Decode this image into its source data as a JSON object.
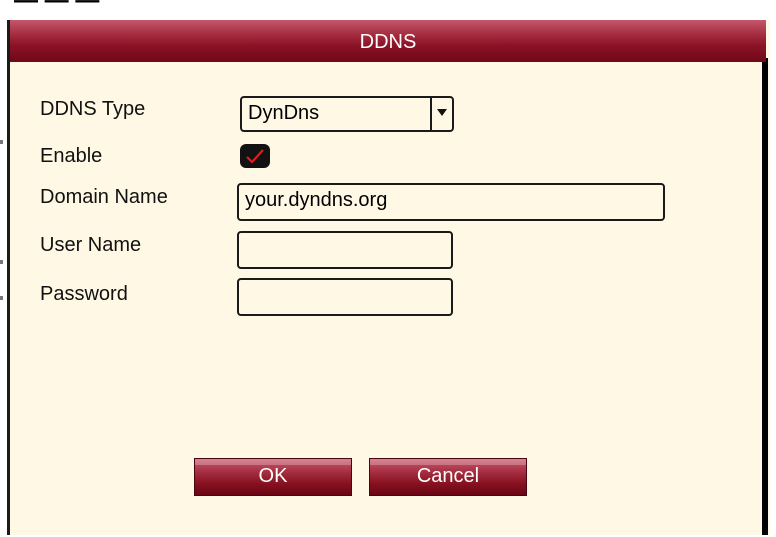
{
  "dialog": {
    "title": "DDNS"
  },
  "form": {
    "ddns_type_label": "DDNS Type",
    "ddns_type_value": "DynDns",
    "enable_label": "Enable",
    "enable_checked": true,
    "domain_name_label": "Domain Name",
    "domain_name_value": "your.dyndns.org",
    "user_name_label": "User Name",
    "user_name_value": "",
    "password_label": "Password",
    "password_value": ""
  },
  "buttons": {
    "ok_label": "OK",
    "cancel_label": "Cancel"
  },
  "colors": {
    "accent": "#8b1326",
    "panel_bg": "#fff8e4",
    "check_mark": "#e21b1b"
  },
  "icons": {
    "select_arrow": "triangle-down-icon",
    "check": "check-icon"
  }
}
